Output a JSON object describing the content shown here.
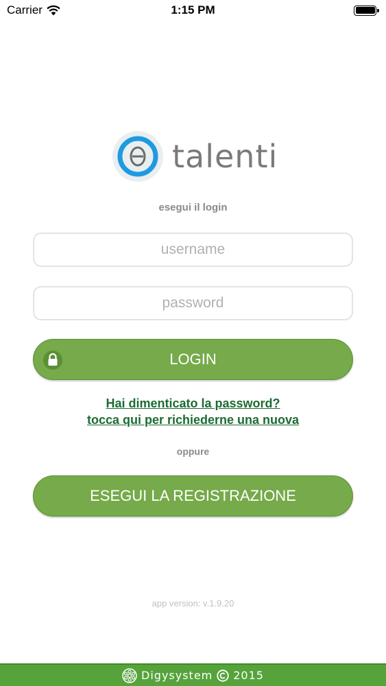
{
  "status_bar": {
    "carrier": "Carrier",
    "time": "1:15 PM",
    "icons": [
      "wifi-icon",
      "battery-icon"
    ]
  },
  "logo": {
    "text": "talenti",
    "mark_symbol": "Θ",
    "colors": {
      "ring": "#1e9be0",
      "text": "#7a7a7a"
    }
  },
  "login": {
    "subtitle": "esegui il login",
    "username_placeholder": "username",
    "password_placeholder": "password",
    "login_label": "LOGIN",
    "forgot_line1": "Hai dimenticato la password?",
    "forgot_line2": "tocca qui per richiederne una nuova",
    "separator": "oppure",
    "register_label": "ESEGUI LA REGISTRAZIONE"
  },
  "app_version": "app version: v.1.9.20",
  "footer": {
    "brand": "Digysystem",
    "year": "2015",
    "icons": [
      "digysystem-logo-icon",
      "copyright-icon"
    ]
  },
  "colors": {
    "button_green": "#76aa4a",
    "link_green": "#1b6b32",
    "footer_green": "#56a33c"
  }
}
